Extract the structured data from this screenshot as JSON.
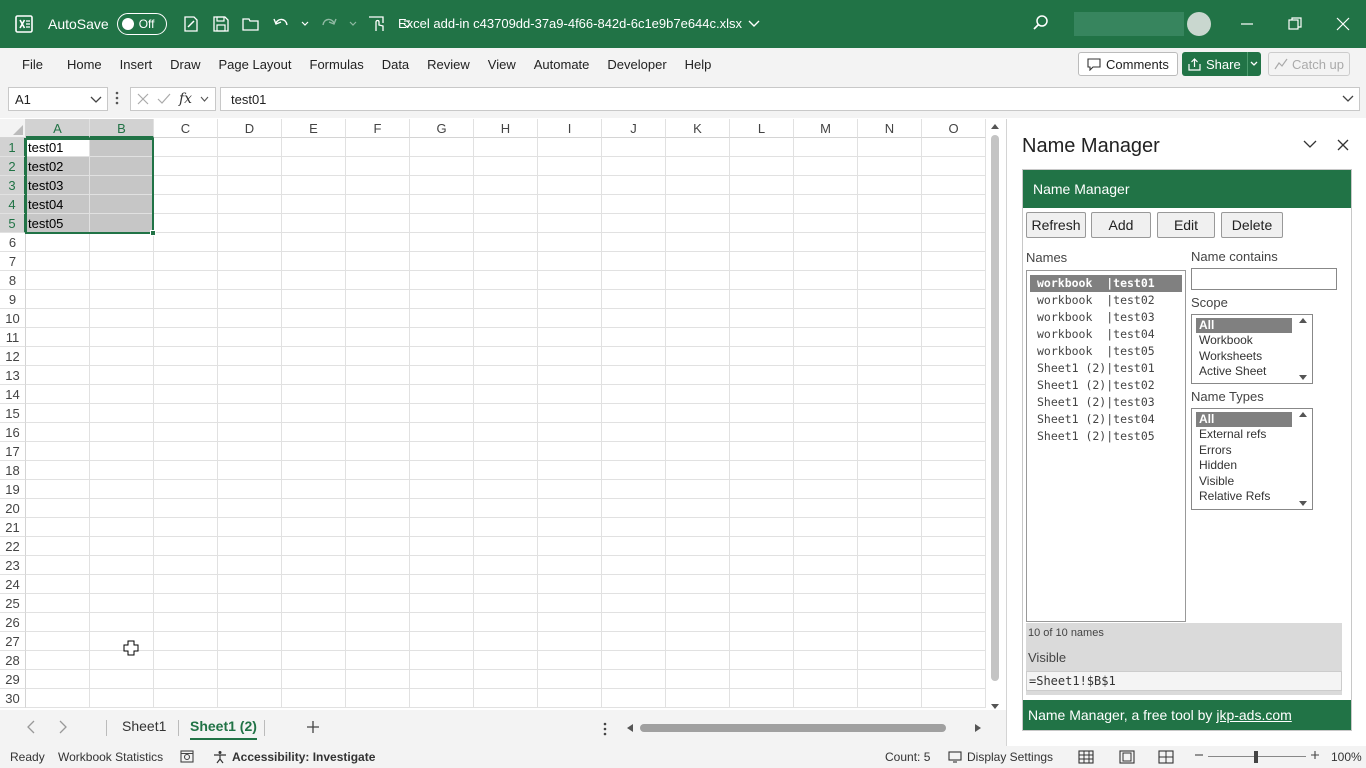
{
  "titlebar": {
    "autosave_label": "AutoSave",
    "autosave_state": "Off",
    "file_title": "Excel add-in c43709dd-37a9-4f66-842d-6c1e9b7e644c.xlsx"
  },
  "ribbon": {
    "tabs": [
      "File",
      "Home",
      "Insert",
      "Draw",
      "Page Layout",
      "Formulas",
      "Data",
      "Review",
      "View",
      "Automate",
      "Developer",
      "Help"
    ],
    "comments_label": "Comments",
    "share_label": "Share",
    "catchup_label": "Catch up"
  },
  "formula_bar": {
    "name_box": "A1",
    "fx": "fx",
    "content": "test01"
  },
  "grid": {
    "columns": [
      "A",
      "B",
      "C",
      "D",
      "E",
      "F",
      "G",
      "H",
      "I",
      "J",
      "K",
      "L",
      "M",
      "N",
      "O"
    ],
    "row_count": 30,
    "cells": {
      "A1": "test01",
      "A2": "test02",
      "A3": "test03",
      "A4": "test04",
      "A5": "test05"
    }
  },
  "sheets": {
    "tabs": [
      "Sheet1",
      "Sheet1 (2)"
    ],
    "active": "Sheet1 (2)"
  },
  "statusbar": {
    "ready": "Ready",
    "workbook_statistics": "Workbook Statistics",
    "accessibility": "Accessibility: Investigate",
    "count": "Count: 5",
    "display_settings": "Display Settings",
    "zoom": "100%"
  },
  "pane": {
    "title": "Name Manager",
    "addin_header": "Name Manager",
    "buttons": {
      "refresh": "Refresh",
      "add": "Add",
      "edit": "Edit",
      "delete": "Delete"
    },
    "names_label": "Names",
    "names": [
      "workbook  |test01",
      "workbook  |test02",
      "workbook  |test03",
      "workbook  |test04",
      "workbook  |test05",
      "Sheet1 (2)|test01",
      "Sheet1 (2)|test02",
      "Sheet1 (2)|test03",
      "Sheet1 (2)|test04",
      "Sheet1 (2)|test05"
    ],
    "selected_name_index": 0,
    "name_contains_label": "Name contains",
    "name_contains_value": "",
    "scope_label": "Scope",
    "scope_options": [
      "All",
      "Workbook",
      "Worksheets",
      "Active Sheet"
    ],
    "name_types_label": "Name Types",
    "name_types_options": [
      "All",
      "External refs",
      "Errors",
      "Hidden",
      "Visible",
      "Relative Refs"
    ],
    "count_text": "10 of 10 names",
    "visibility": "Visible",
    "refers_to": "=Sheet1!$B$1",
    "footer_text": "Name Manager, a free tool by ",
    "footer_link": "jkp-ads.com"
  },
  "colors": {
    "excel_green": "#217346",
    "selection_fill": "#c6c6c6"
  }
}
